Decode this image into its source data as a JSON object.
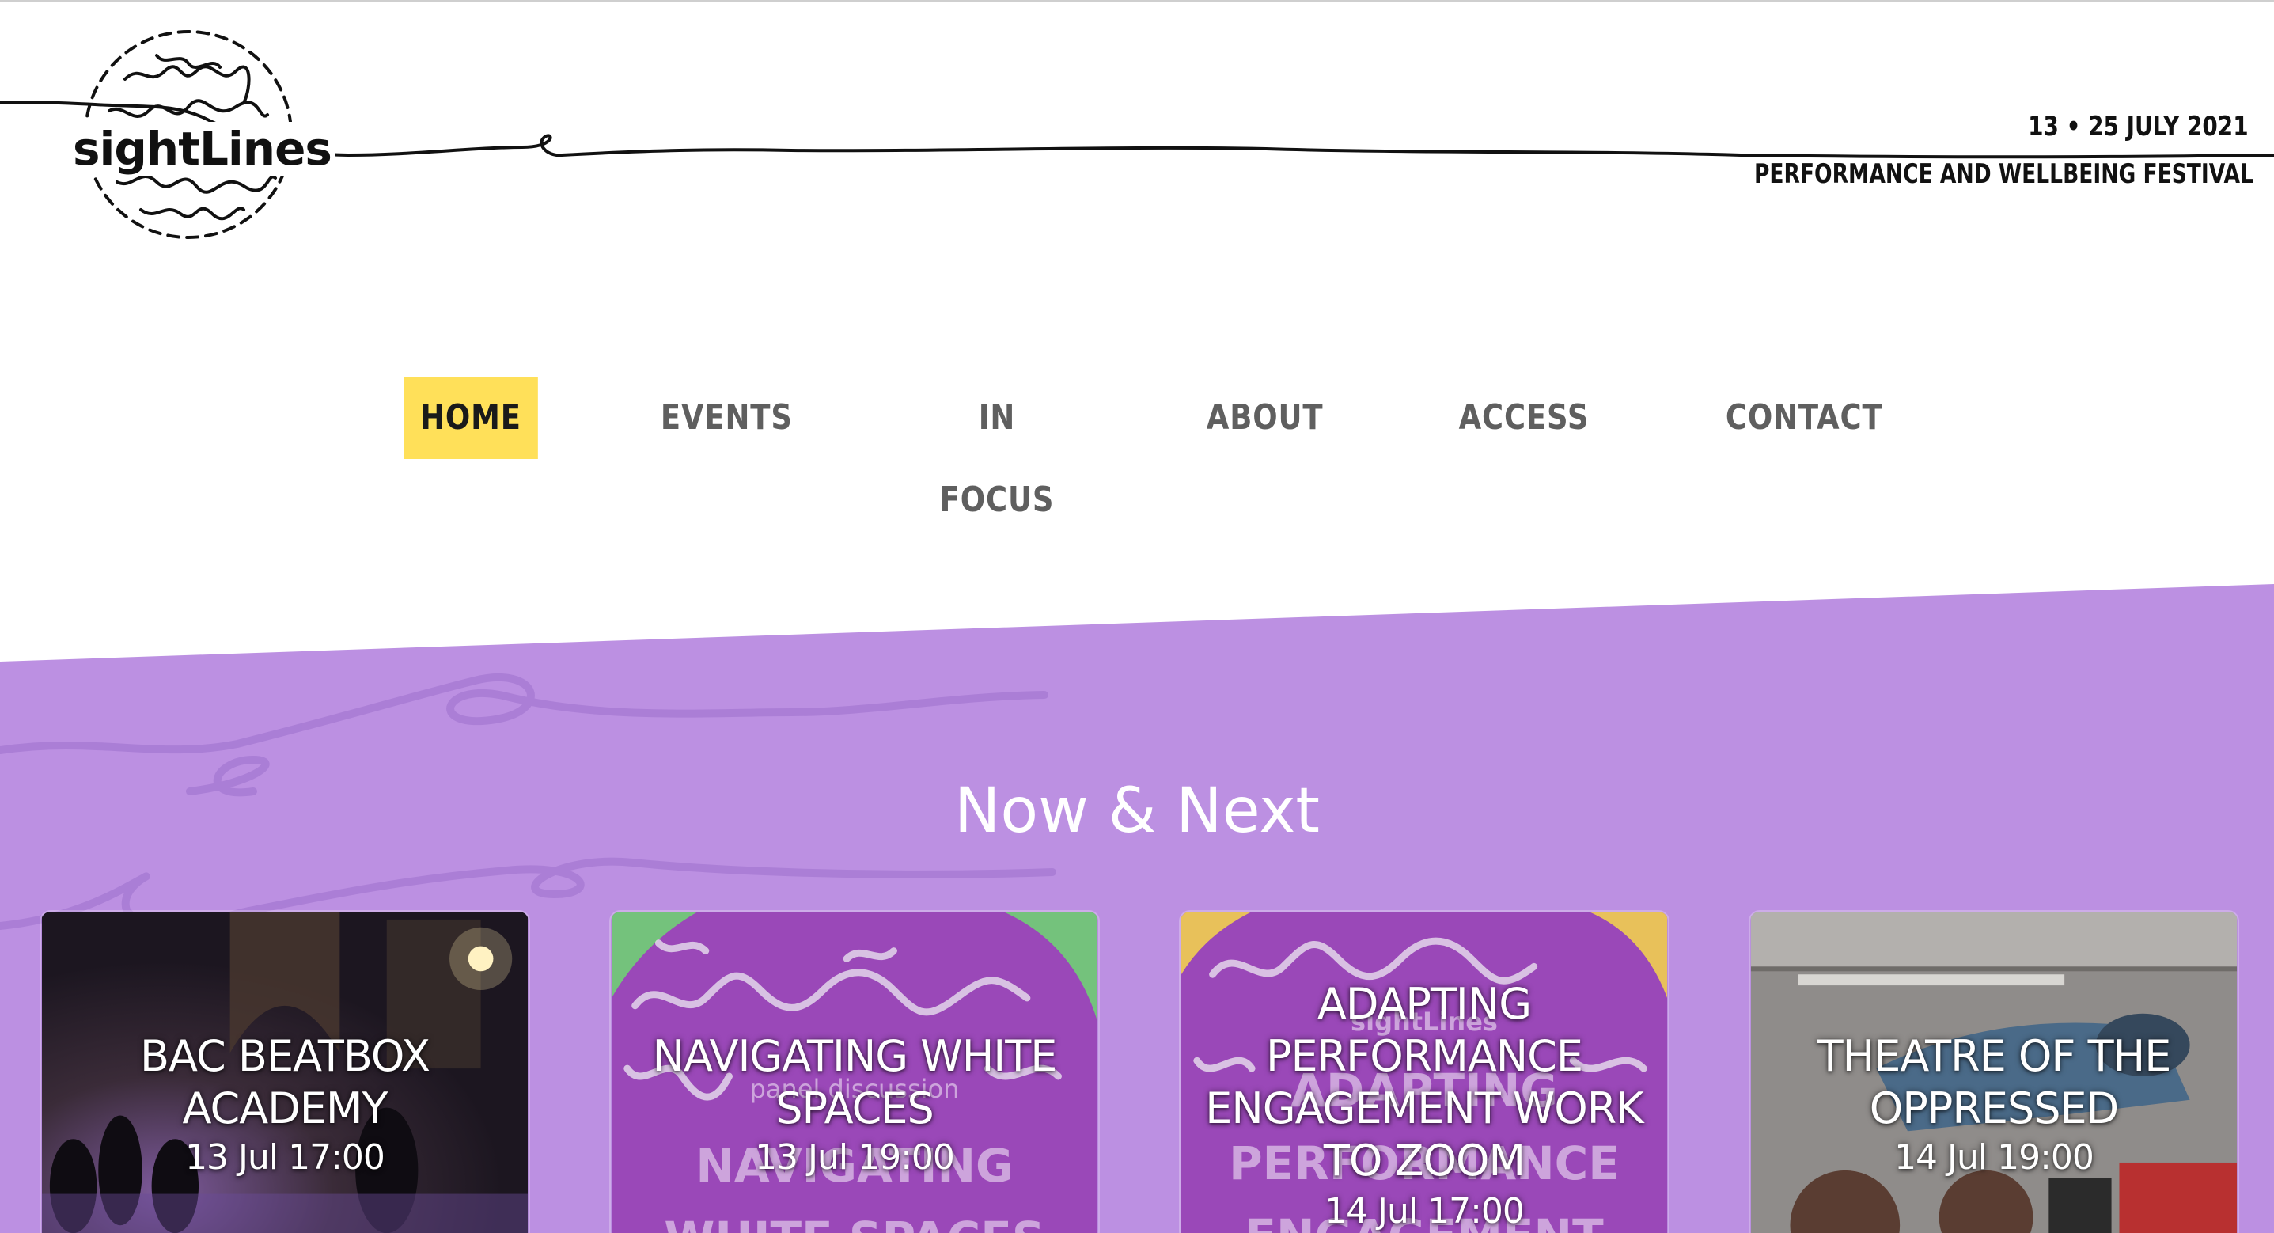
{
  "header": {
    "logo_text": "sightLines",
    "festival_dates": "13 • 25 JULY 2021",
    "festival_subtitle": "PERFORMANCE AND WELLBEING FESTIVAL"
  },
  "nav": {
    "items": [
      {
        "label": "HOME",
        "active": true
      },
      {
        "label": "EVENTS",
        "active": false
      },
      {
        "label": "IN FOCUS",
        "active": false
      },
      {
        "label": "ABOUT",
        "active": false
      },
      {
        "label": "ACCESS",
        "active": false
      },
      {
        "label": "CONTACT",
        "active": false
      }
    ]
  },
  "now_next": {
    "title": "Now & Next",
    "cards": [
      {
        "title": "BAC BEATBOX ACADEMY",
        "date": "13 Jul 17:00"
      },
      {
        "title": "NAVIGATING WHITE SPACES",
        "date": "13 Jul 19:00",
        "poster_small": "panel discussion",
        "poster_large": "NAVIGATING WHITE SPACES"
      },
      {
        "title": "ADAPTING PERFORMANCE ENGAGEMENT WORK TO ZOOM",
        "date": "14 Jul 17:00",
        "poster_small": "sightLines",
        "poster_large": "ADAPTING PERFORMANCE ENGAGEMENT"
      },
      {
        "title": "THEATRE OF THE OPPRESSED",
        "date": "14 Jul 19:00"
      }
    ]
  },
  "colors": {
    "purple": "#bc90e2",
    "highlight": "#ffe059",
    "nav_text": "#5f5f5f"
  }
}
